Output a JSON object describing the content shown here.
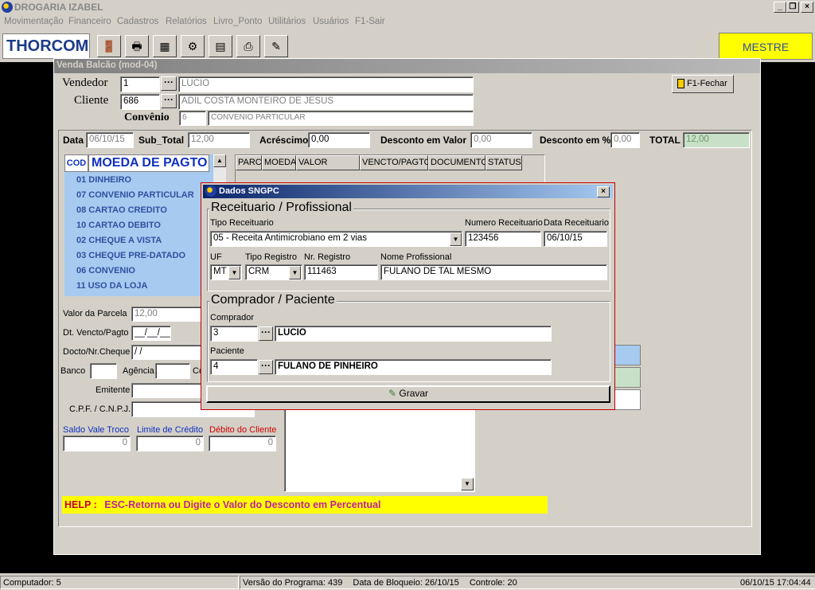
{
  "app": {
    "title": "DROGARIA IZABEL"
  },
  "menu": [
    "Movimentação",
    "Financeiro",
    "Cadastros",
    "Relatórios",
    "Livro_Ponto",
    "Utilitários",
    "Usuários",
    "F1-Sair"
  ],
  "toolbar": {
    "logo": "THORCOM",
    "mestre": "MESTRE"
  },
  "main": {
    "title": "Venda Balcão (mod-04)",
    "close_btn": "F1-Fechar",
    "vendedor_label": "Vendedor",
    "vendedor_code": "1",
    "vendedor_name": "LUCIO",
    "cliente_label": "Cliente",
    "cliente_code": "686",
    "cliente_name": "ADIL COSTA MONTEIRO DE JESUS",
    "convenio_label": "Convênio",
    "convenio_code": "6",
    "convenio_name": "CONVENIO PARTICULAR",
    "data_label": "Data",
    "data_value": "06/10/15",
    "subtotal_label": "Sub_Total",
    "subtotal_value": "12,00",
    "acrescimo_label": "Acréscimo",
    "acrescimo_value": "0,00",
    "desc_valor_label": "Desconto em Valor",
    "desc_valor_value": "0,00",
    "desc_perc_label": "Desconto em %",
    "desc_perc_value": "0,00",
    "total_label": "TOTAL",
    "total_value": "12,00"
  },
  "moeda": {
    "header_cod": "COD",
    "header_name": "MOEDA DE PAGTO",
    "items": [
      "01  DINHEIRO",
      "07  CONVENIO PARTICULAR",
      "08  CARTAO CREDITO",
      "10  CARTAO DEBITO",
      "02  CHEQUE A VISTA",
      "03  CHEQUE PRE-DATADO",
      "06  CONVENIO",
      "11  USO DA LOJA"
    ]
  },
  "parc_grid": {
    "headers": [
      "PARC",
      "MOEDA",
      "VALOR",
      "VENCTO/PAGTO",
      "DOCUMENTO",
      "STATUS"
    ]
  },
  "payment": {
    "valor_parcela_label": "Valor da Parcela",
    "valor_parcela_value": "12,00",
    "dt_vencto_label": "Dt. Vencto/Pagto",
    "dt_vencto_value": "__/__/__",
    "docto_label": "Docto/Nr.Cheque",
    "docto_value": "/ /",
    "banco_label": "Banco",
    "agencia_label": "Agência",
    "conta_label": "Co",
    "emitente_label": "Emitente",
    "cpf_label": "C.P.F. / C.N.P.J.",
    "saldo_label": "Saldo Vale Troco",
    "saldo_value": "0",
    "limite_label": "Limite de Crédito",
    "limite_value": "0",
    "debito_label": "Débito do Cliente",
    "debito_value": "0"
  },
  "help": {
    "prefix": "HELP :",
    "text": "ESC-Retorna ou Digite o Valor do Desconto em Percentual"
  },
  "dialog": {
    "title": "Dados SNGPC",
    "group1_title": "Receituario / Profissional",
    "tipo_receituario_label": "Tipo Receituario",
    "tipo_receituario_value": "05 - Receita Antimicrobiano em 2 vias",
    "numero_receituario_label": "Numero Receituario",
    "numero_receituario_value": "123456",
    "data_receituario_label": "Data Receituario",
    "data_receituario_value": "06/10/15",
    "uf_label": "UF",
    "uf_value": "MT",
    "tipo_registro_label": "Tipo Registro",
    "tipo_registro_value": "CRM",
    "nr_registro_label": "Nr. Registro",
    "nr_registro_value": "111463",
    "nome_profissional_label": "Nome Profissional",
    "nome_profissional_value": "FULANO DE TAL MESMO",
    "group2_title": "Comprador / Paciente",
    "comprador_label": "Comprador",
    "comprador_code": "3",
    "comprador_name": "LUCIO",
    "paciente_label": "Paciente",
    "paciente_code": "4",
    "paciente_name": "FULANO DE PINHEIRO",
    "gravar": "Gravar"
  },
  "status": {
    "computador": "Computador: 5",
    "versao": "Versão do Programa: 439",
    "bloqueio": "Data de Bloqueio: 26/10/15",
    "controle": "Controle: 20",
    "datetime": "06/10/15 17:04:44"
  }
}
